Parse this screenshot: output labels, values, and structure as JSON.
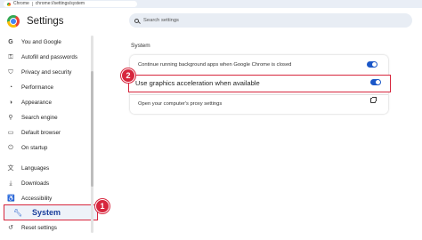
{
  "browser": {
    "tab_label": "Chrome",
    "url": "chrome://settings/system"
  },
  "header": {
    "title": "Settings",
    "search_placeholder": "Search settings"
  },
  "sidebar": {
    "items": [
      {
        "label": "You and Google",
        "icon": "google-g-icon"
      },
      {
        "label": "Autofill and passwords",
        "icon": "key-icon"
      },
      {
        "label": "Privacy and security",
        "icon": "shield-icon"
      },
      {
        "label": "Performance",
        "icon": "speedometer-icon"
      },
      {
        "label": "Appearance",
        "icon": "palette-icon"
      },
      {
        "label": "Search engine",
        "icon": "search-icon"
      },
      {
        "label": "Default browser",
        "icon": "browser-icon"
      },
      {
        "label": "On startup",
        "icon": "power-icon"
      },
      {
        "label": "Languages",
        "icon": "translate-icon"
      },
      {
        "label": "Downloads",
        "icon": "download-icon"
      },
      {
        "label": "Accessibility",
        "icon": "accessibility-icon"
      },
      {
        "label": "System",
        "icon": "wrench-icon",
        "selected": true
      },
      {
        "label": "Reset settings",
        "icon": "reset-icon"
      }
    ]
  },
  "main": {
    "section_title": "System",
    "rows": [
      {
        "label": "Continue running background apps when Google Chrome is closed",
        "control": "toggle",
        "on": true
      },
      {
        "label": "Use graphics acceleration when available",
        "control": "toggle",
        "on": true,
        "highlighted": true
      },
      {
        "label": "Open your computer's proxy settings",
        "control": "external-link"
      }
    ]
  },
  "annotations": {
    "badge_1": "1",
    "badge_2": "2"
  },
  "colors": {
    "accent": "#1a57c8",
    "highlight": "#d7263d",
    "search_bg": "#e8edf4"
  }
}
